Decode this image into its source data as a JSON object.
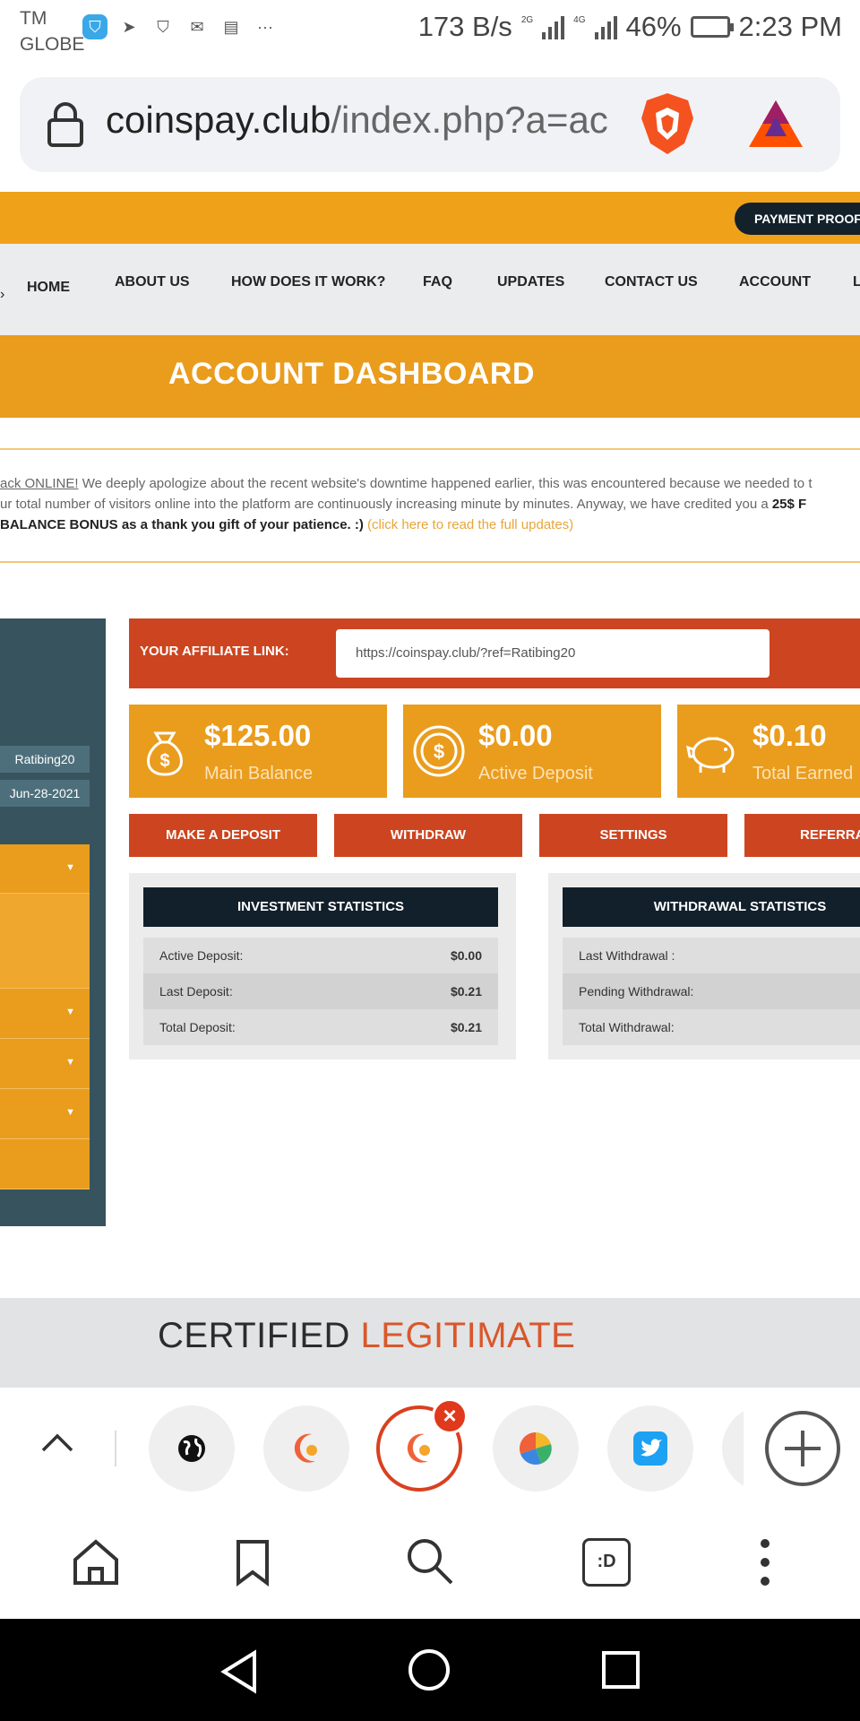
{
  "status_bar": {
    "carrier_line1": "TM",
    "carrier_line2": "GLOBE",
    "more": "···",
    "net_speed": "173 B/s",
    "net1": "2G",
    "net2": "4G",
    "battery": "46%",
    "time": "2:23 PM"
  },
  "browser": {
    "url_host": "coinspay.club",
    "url_path": "/index.php?a=ac"
  },
  "site": {
    "payment_proofs": "PAYMENT PROOFS",
    "nav": [
      "HOME",
      "ABOUT US",
      "HOW DOES IT WORK?",
      "FAQ",
      "UPDATES",
      "CONTACT US",
      "ACCOUNT",
      "L"
    ],
    "banner_title": "ACCOUNT DASHBOARD",
    "notice": {
      "l1_link": "ack ONLINE!",
      "l1_text": " We deeply apologize about the recent website's downtime happened earlier, this was encountered because we needed to t",
      "l2_text": "ur total number of visitors online into the platform are continuously increasing minute by minutes. Anyway, we have credited you a ",
      "l2_bold": "25$ F",
      "l3_bold": "BALANCE BONUS as a thank you gift of your patience. :)",
      "l3_link": " (click here to read the full updates)"
    },
    "sidebar": {
      "username": "Ratibing20",
      "date": "Jun-28-2021"
    },
    "affiliate": {
      "label": "YOUR AFFILIATE LINK:",
      "link": "https://coinspay.club/?ref=Ratibing20"
    },
    "cards": [
      {
        "value": "$125.00",
        "label": "Main Balance",
        "icon": "money-bag-icon"
      },
      {
        "value": "$0.00",
        "label": "Active Deposit",
        "icon": "coin-icon"
      },
      {
        "value": "$0.10",
        "label": "Total Earned",
        "icon": "piggy-bank-icon"
      }
    ],
    "buttons": [
      "MAKE A DEPOSIT",
      "WITHDRAW",
      "SETTINGS",
      "REFERRA"
    ],
    "investment": {
      "title": "INVESTMENT STATISTICS",
      "rows": [
        {
          "k": "Active Deposit:",
          "v": "$0.00"
        },
        {
          "k": "Last Deposit:",
          "v": "$0.21"
        },
        {
          "k": "Total Deposit:",
          "v": "$0.21"
        }
      ]
    },
    "withdrawal": {
      "title": "WITHDRAWAL STATISTICS",
      "rows": [
        {
          "k": "Last Withdrawal :",
          "v": ""
        },
        {
          "k": "Pending Withdrawal:",
          "v": ""
        },
        {
          "k": "Total Withdrawal:",
          "v": ""
        }
      ]
    },
    "certified": "CERTIFIED",
    "legitimate": "LEGITIMATE"
  },
  "toolbar": {
    "tabs_label": ":D"
  },
  "colors": {
    "orange": "#ea9c1d",
    "red": "#cc4520",
    "dark": "#11202b",
    "sidebar": "#37535d"
  }
}
